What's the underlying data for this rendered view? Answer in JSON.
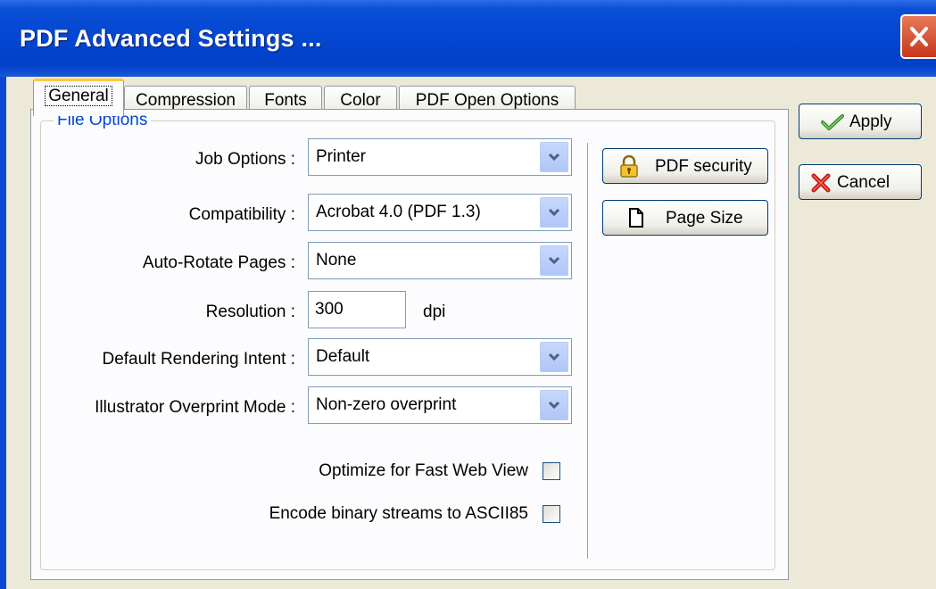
{
  "window": {
    "title": "PDF Advanced Settings ...",
    "close_icon": "close-icon"
  },
  "tabs": [
    {
      "label": "General",
      "active": true
    },
    {
      "label": "Compression",
      "active": false
    },
    {
      "label": "Fonts",
      "active": false
    },
    {
      "label": "Color",
      "active": false
    },
    {
      "label": "PDF Open Options",
      "active": false
    }
  ],
  "file_options": {
    "group_label": "File Options",
    "job_options": {
      "label": "Job Options :",
      "value": "Printer"
    },
    "compatibility": {
      "label": "Compatibility :",
      "value": "Acrobat 4.0 (PDF 1.3)"
    },
    "auto_rotate": {
      "label": "Auto-Rotate Pages :",
      "value": "None"
    },
    "resolution": {
      "label": "Resolution :",
      "value": "300",
      "unit": "dpi"
    },
    "rendering_intent": {
      "label": "Default Rendering Intent :",
      "value": "Default"
    },
    "overprint_mode": {
      "label": "Illustrator Overprint Mode :",
      "value": "Non-zero overprint"
    },
    "fast_web_view": {
      "label": "Optimize for Fast Web View",
      "checked": false
    },
    "ascii85": {
      "label": "Encode binary streams to ASCII85",
      "checked": false
    }
  },
  "side_buttons": {
    "pdf_security": {
      "label": "PDF security",
      "icon": "lock-icon"
    },
    "page_size": {
      "label": "Page Size",
      "icon": "page-icon"
    }
  },
  "actions": {
    "apply": {
      "label": "Apply",
      "icon": "checkmark-icon"
    },
    "cancel": {
      "label": "Cancel",
      "icon": "red-x-icon"
    }
  },
  "colors": {
    "titlebar": "#0346d1",
    "face": "#ece9d8",
    "group_label": "#0046d5",
    "active_tab_accent": "#ffc83c"
  }
}
